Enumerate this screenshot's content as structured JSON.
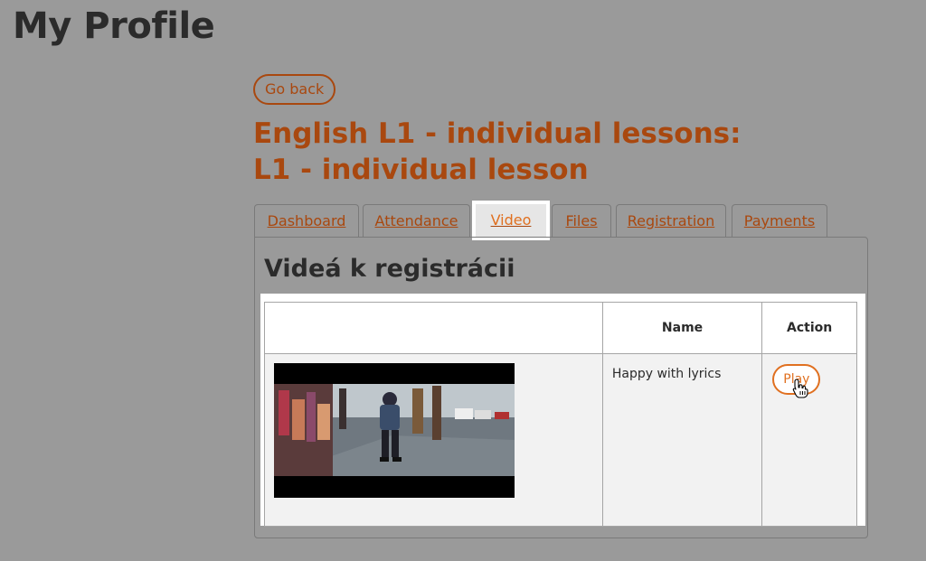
{
  "page": {
    "title": "My Profile"
  },
  "go_back": {
    "label": "Go back"
  },
  "course": {
    "title": "English L1 - individual lessons: L1 - individual lesson"
  },
  "tabs": [
    {
      "label": "Dashboard",
      "active": false
    },
    {
      "label": "Attendance",
      "active": false
    },
    {
      "label": "Video",
      "active": true
    },
    {
      "label": "Files",
      "active": false
    },
    {
      "label": "Registration",
      "active": false
    },
    {
      "label": "Payments",
      "active": false
    }
  ],
  "panel": {
    "heading": "Videá k registrácii",
    "table": {
      "headers": [
        "",
        "Name",
        "Action"
      ],
      "rows": [
        {
          "thumbnail": "video-thumbnail-image",
          "name": "Happy with lyrics",
          "action": "Play"
        }
      ]
    }
  },
  "icons": {
    "cursor": "hand-pointer-icon"
  },
  "colors": {
    "accent_dark": "#a9480f",
    "accent": "#e07020",
    "background": "#9a9a9a",
    "heading_text": "#2b2b2b"
  }
}
